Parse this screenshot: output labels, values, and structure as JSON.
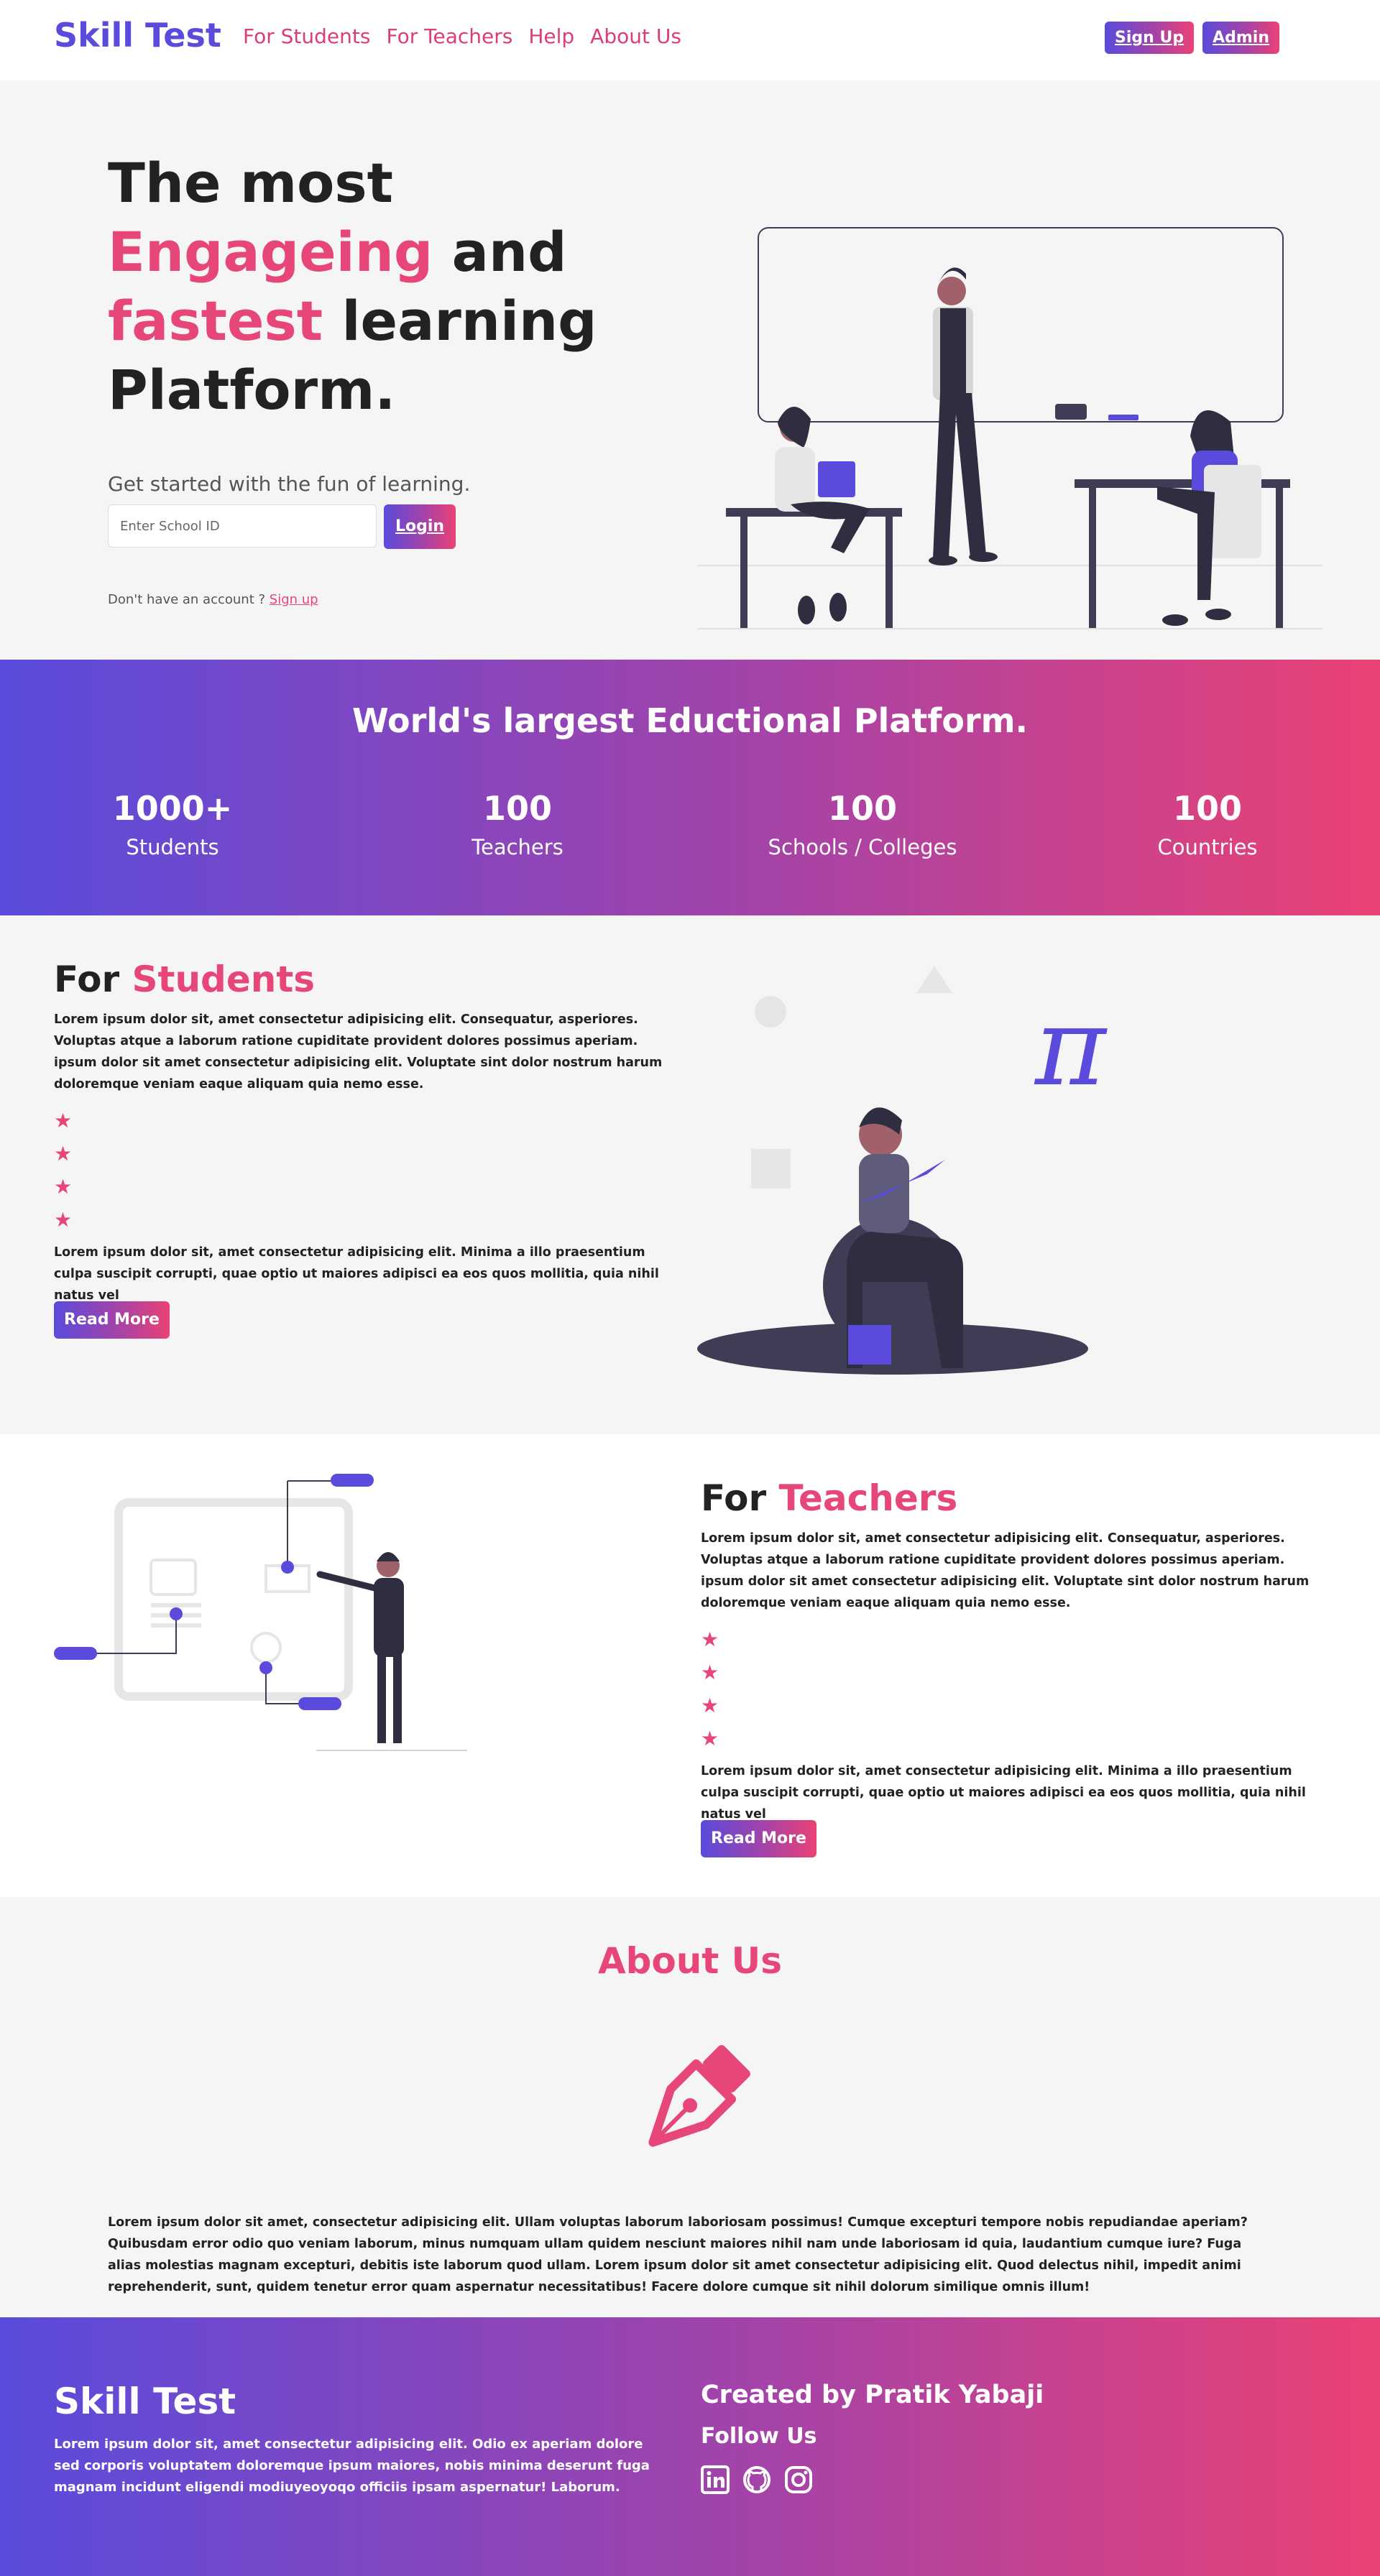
{
  "nav": {
    "brand": "Skill Test",
    "links": [
      "For Students",
      "For Teachers",
      "Help",
      "About Us"
    ],
    "signup": "Sign Up",
    "admin": "Admin"
  },
  "hero": {
    "line1": "The most",
    "line2_accent": "Engageing",
    "line2_rest": " and",
    "line3_accent": "fastest",
    "line3_rest": " learning",
    "line4": "Platform.",
    "subtitle": "Get started with the fun of learning.",
    "input_placeholder": "Enter School ID",
    "login": "Login",
    "account_text": "Don't have an account ?",
    "account_link": "Sign up"
  },
  "stats": {
    "title": "World's largest Eductional Platform.",
    "items": [
      {
        "num": "1000+",
        "label": "Students"
      },
      {
        "num": "100",
        "label": "Teachers"
      },
      {
        "num": "100",
        "label": "Schools / Colleges"
      },
      {
        "num": "100",
        "label": "Countries"
      }
    ]
  },
  "students": {
    "title_plain": "For ",
    "title_accent": "Students",
    "p1": "Lorem ipsum dolor sit, amet consectetur adipisicing elit. Consequatur, asperiores. Voluptas atque a laborum ratione cupiditate provident dolores possimus aperiam. ipsum dolor sit amet consectetur adipisicing elit. Voluptate sint dolor nostrum harum doloremque veniam eaque aliquam quia nemo esse.",
    "stars": [
      "★",
      "★",
      "★",
      "★"
    ],
    "p2": "Lorem ipsum dolor sit, amet consectetur adipisicing elit. Minima a illo praesentium culpa suscipit corrupti, quae optio ut maiores adipisci ea eos quos mollitia, quia nihil natus vel",
    "button": "Read More",
    "pi": "π"
  },
  "teachers": {
    "title_plain": "For ",
    "title_accent": "Teachers",
    "p1": "Lorem ipsum dolor sit, amet consectetur adipisicing elit. Consequatur, asperiores. Voluptas atque a laborum ratione cupiditate provident dolores possimus aperiam. ipsum dolor sit amet consectetur adipisicing elit. Voluptate sint dolor nostrum harum doloremque veniam eaque aliquam quia nemo esse.",
    "stars": [
      "★",
      "★",
      "★",
      "★"
    ],
    "p2": "Lorem ipsum dolor sit, amet consectetur adipisicing elit. Minima a illo praesentium culpa suscipit corrupti, quae optio ut maiores adipisci ea eos quos mollitia, quia nihil natus vel",
    "button": "Read More"
  },
  "about": {
    "title": "About Us",
    "text": "Lorem ipsum dolor sit amet, consectetur adipisicing elit. Ullam voluptas laborum laboriosam possimus! Cumque excepturi tempore nobis repudiandae aperiam? Quibusdam error odio quo veniam laborum, minus numquam ullam quidem nesciunt maiores nihil nam unde laboriosam id quia, laudantium cumque iure? Fuga alias molestias magnam excepturi, debitis iste laborum quod ullam. Lorem ipsum dolor sit amet consectetur adipisicing elit. Quod delectus nihil, impedit animi reprehenderit, sunt, quidem tenetur error quam aspernatur necessitatibus! Facere dolore cumque sit nihil dolorum similique omnis illum!"
  },
  "footer": {
    "brand": "Skill Test",
    "text": "Lorem ipsum dolor sit, amet consectetur adipisicing elit. Odio ex aperiam dolore sed corporis voluptatem doloremque ipsum maiores, nobis minima deserunt fuga magnam incidunt eligendi modiuyeoyoqo officiis ipsam aspernatur! Laborum.",
    "created": "Created by Pratik Yabaji",
    "follow": "Follow Us",
    "socials": [
      "linkedin-icon",
      "github-icon",
      "instagram-icon"
    ]
  },
  "colors": {
    "primary": "#5a4bdc",
    "accent": "#e64678",
    "dark": "#2f2e41"
  }
}
